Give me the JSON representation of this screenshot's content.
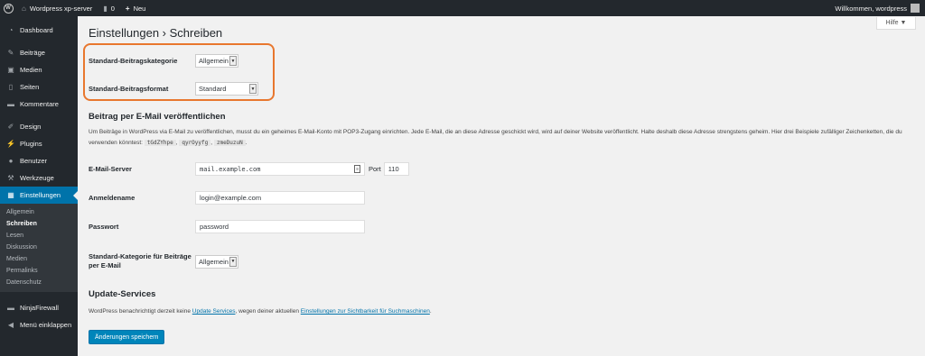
{
  "adminbar": {
    "site_name": "Wordpress xp-server",
    "comments_count": "0",
    "new_label": "Neu",
    "welcome": "Willkommen, wordpress"
  },
  "sidebar": {
    "items": [
      {
        "label": "Dashboard",
        "icon": "dashboard-icon"
      },
      {
        "label": "Beiträge",
        "icon": "pin-icon"
      },
      {
        "label": "Medien",
        "icon": "media-icon"
      },
      {
        "label": "Seiten",
        "icon": "page-icon"
      },
      {
        "label": "Kommentare",
        "icon": "comment-icon"
      },
      {
        "label": "Design",
        "icon": "brush-icon"
      },
      {
        "label": "Plugins",
        "icon": "plugin-icon"
      },
      {
        "label": "Benutzer",
        "icon": "user-icon"
      },
      {
        "label": "Werkzeuge",
        "icon": "wrench-icon"
      },
      {
        "label": "Einstellungen",
        "icon": "settings-icon"
      }
    ],
    "submenu": [
      "Allgemein",
      "Schreiben",
      "Lesen",
      "Diskussion",
      "Medien",
      "Permalinks",
      "Datenschutz"
    ],
    "ninja": "NinjaFirewall",
    "collapse": "Menü einklappen"
  },
  "help_label": "Hilfe ▼",
  "page_title": "Einstellungen › Schreiben",
  "fields": {
    "default_category_label": "Standard-Beitragskategorie",
    "default_category_value": "Allgemein",
    "default_format_label": "Standard-Beitragsformat",
    "default_format_value": "Standard"
  },
  "email_section": {
    "heading": "Beitrag per E-Mail veröffentlichen",
    "desc_part1": "Um Beiträge in WordPress via E-Mail zu veröffentlichen, musst du ein geheimes E-Mail-Konto mit POP3-Zugang einrichten. Jede E-Mail, die an diese Adresse geschickt wird, wird auf deiner Website veröffentlicht. Halte deshalb diese Adresse strengstens geheim. Hier drei Beispiele zufälliger Zeichenketten, die du verwenden könntest:",
    "codes": [
      "tGdZYhpe",
      "qyrOyyfg",
      "zmeDuzuN"
    ],
    "server_label": "E-Mail-Server",
    "server_value": "mail.example.com",
    "port_label": "Port",
    "port_value": "110",
    "login_label": "Anmeldename",
    "login_value": "login@example.com",
    "password_label": "Passwort",
    "password_value": "password",
    "email_cat_label": "Standard-Kategorie für Beiträge per E-Mail",
    "email_cat_value": "Allgemein"
  },
  "update_section": {
    "heading": "Update-Services",
    "text1": "WordPress benachrichtigt derzeit keine",
    "link1": "Update Services",
    "text2": ", wegen deiner aktuellen",
    "link2": "Einstellungen zur Sichtbarkeit für Suchmaschinen",
    "text3": "."
  },
  "save_label": "Änderungen speichern"
}
